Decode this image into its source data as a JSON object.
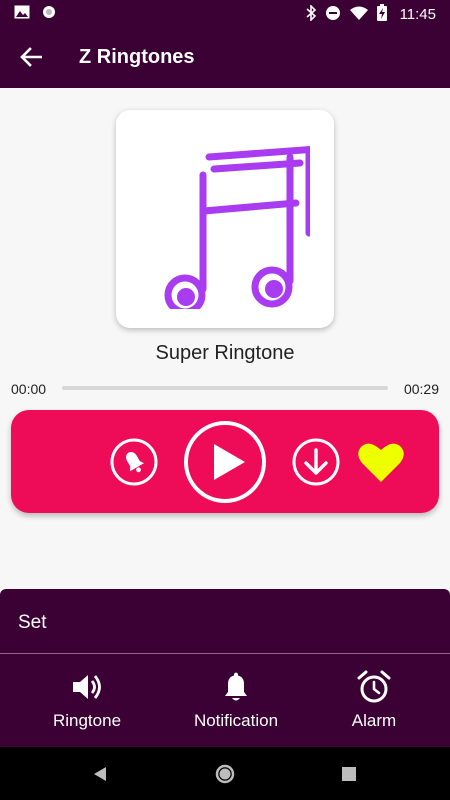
{
  "status_bar": {
    "time": "11:45"
  },
  "app_bar": {
    "title": "Z Ringtones"
  },
  "player": {
    "song_title": "Super Ringtone",
    "time_elapsed": "00:00",
    "time_total": "00:29",
    "progress": 0
  },
  "set_panel": {
    "label": "Set",
    "options": [
      {
        "label": "Ringtone",
        "icon": "speaker-icon"
      },
      {
        "label": "Notification",
        "icon": "bell-icon"
      },
      {
        "label": "Alarm",
        "icon": "alarm-clock-icon"
      }
    ]
  },
  "colors": {
    "primary_dark": "#3b0034",
    "accent_pink": "#ee0b58",
    "music_purple": "#a93cf0",
    "favorite_yellow": "#eeff00"
  }
}
